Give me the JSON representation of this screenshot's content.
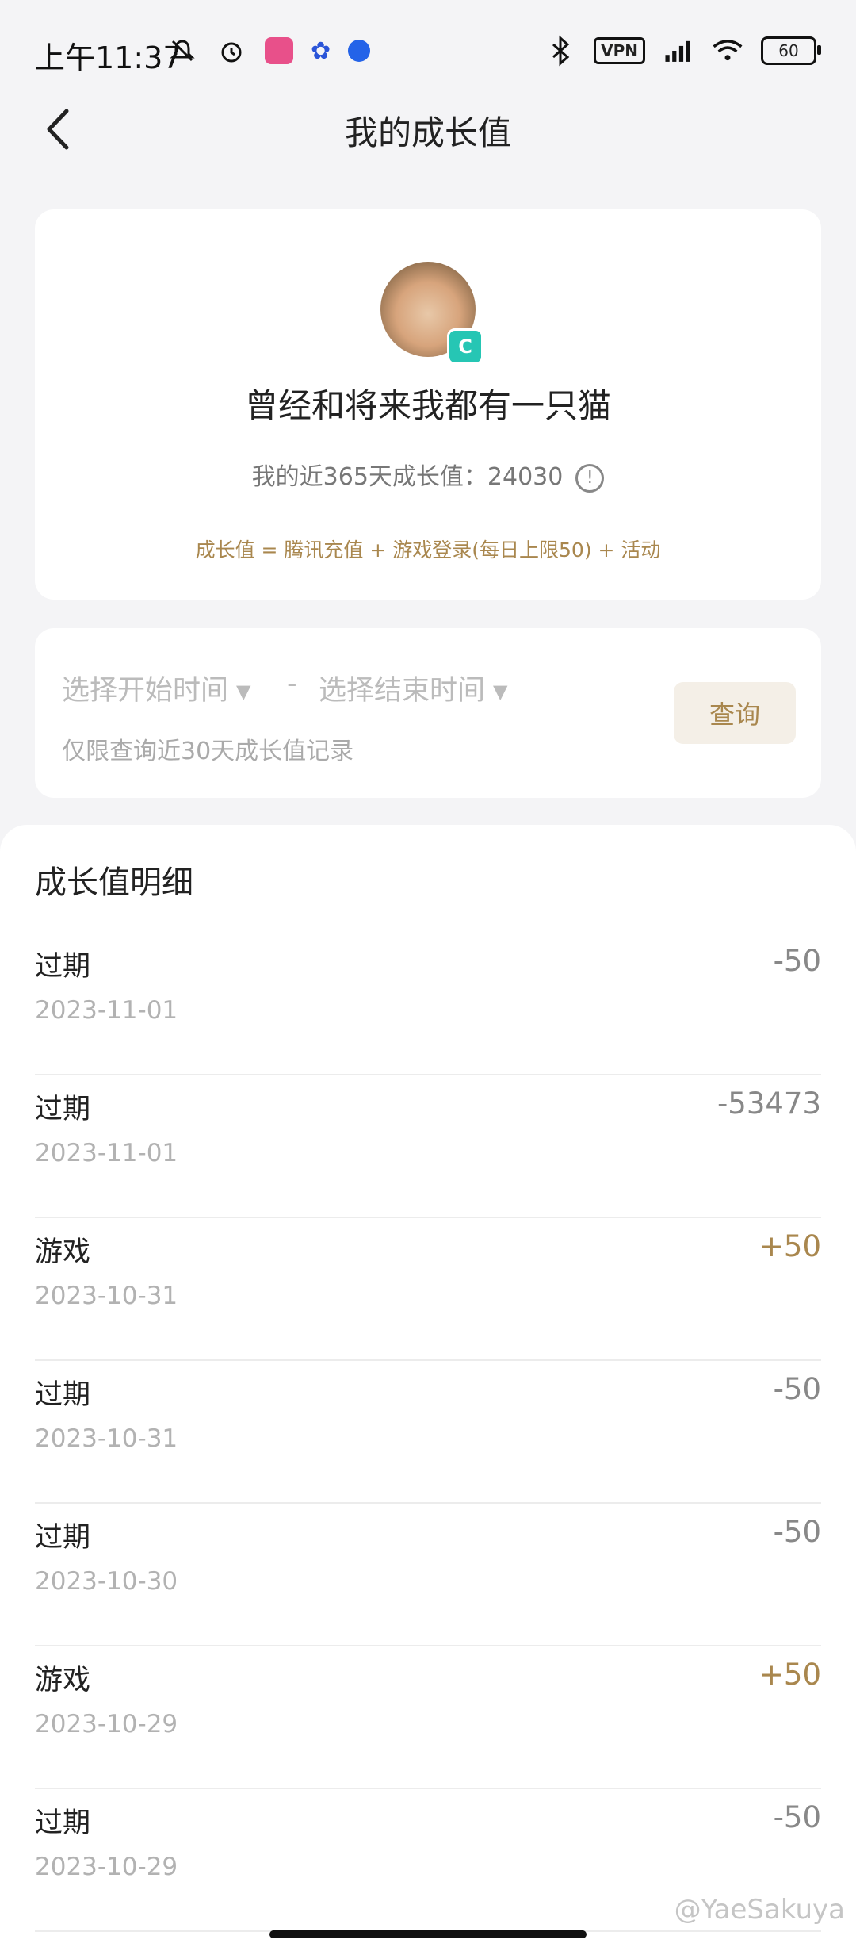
{
  "status_bar": {
    "time": "上午11:37",
    "vpn": "VPN",
    "battery": "60"
  },
  "header": {
    "title": "我的成长值"
  },
  "profile": {
    "avatar_badge": "C",
    "nickname": "曾经和将来我都有一只猫",
    "growth_summary": "我的近365天成长值：24030",
    "formula": "成长值 = 腾讯充值 + 游戏登录(每日上限50) + 活动"
  },
  "query": {
    "start_placeholder": "选择开始时间",
    "separator": "-",
    "end_placeholder": "选择结束时间",
    "hint": "仅限查询近30天成长值记录",
    "button_label": "查询"
  },
  "details": {
    "title": "成长值明细",
    "records": [
      {
        "type": "过期",
        "date": "2023-11-01",
        "amount": "-50"
      },
      {
        "type": "过期",
        "date": "2023-11-01",
        "amount": "-53473"
      },
      {
        "type": "游戏",
        "date": "2023-10-31",
        "amount": "+50"
      },
      {
        "type": "过期",
        "date": "2023-10-31",
        "amount": "-50"
      },
      {
        "type": "过期",
        "date": "2023-10-30",
        "amount": "-50"
      },
      {
        "type": "游戏",
        "date": "2023-10-29",
        "amount": "+50"
      },
      {
        "type": "过期",
        "date": "2023-10-29",
        "amount": "-50"
      }
    ]
  },
  "watermark": "@YaeSakuya",
  "colors": {
    "accent_gold": "#a9874e",
    "negative_gray": "#888888",
    "background": "#f4f4f6"
  }
}
